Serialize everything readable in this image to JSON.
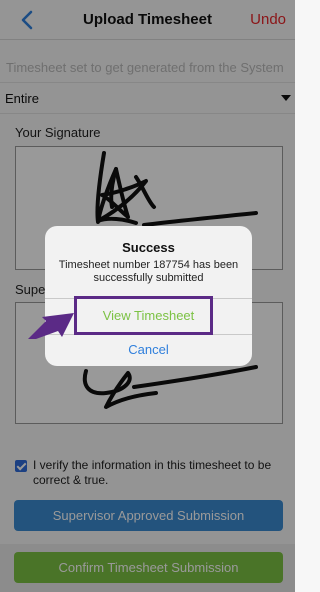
{
  "header": {
    "title": "Upload Timesheet",
    "undo_label": "Undo",
    "back_icon": "chevron-left-icon"
  },
  "form": {
    "generated_note": "Timesheet set to get generated from the System",
    "period_select": {
      "value": "Entire"
    },
    "your_signature_label": "Your Signature",
    "supervisor_signature_label": "Supervisor Signature",
    "verify_checkbox": {
      "checked": true,
      "text": "I verify the information in this timesheet to be correct & true."
    },
    "supervisor_button_label": "Supervisor Approved Submission",
    "confirm_button_label": "Confirm Timesheet Submission"
  },
  "alert": {
    "title": "Success",
    "message": "Timesheet number 187754 has been successfully submitted",
    "view_button_label": "View Timesheet",
    "cancel_button_label": "Cancel"
  },
  "colors": {
    "accent_blue": "#3b8ad0",
    "accent_green": "#7cc244",
    "undo_red": "#e8262a",
    "highlight_purple": "#5b2a86"
  }
}
